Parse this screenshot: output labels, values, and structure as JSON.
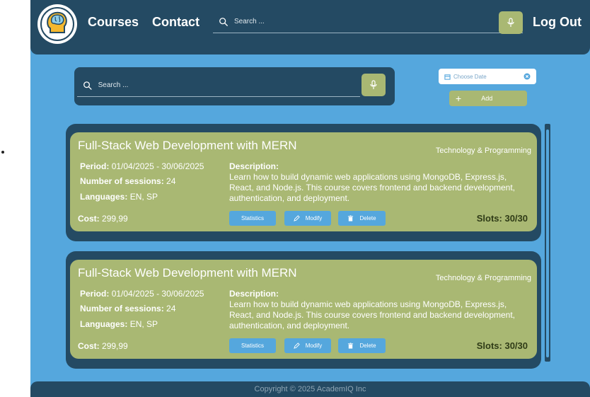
{
  "nav": {
    "courses": "Courses",
    "contact": "Contact",
    "search_placeholder": "Search ...",
    "logout": "Log Out"
  },
  "toolbar": {
    "search_placeholder": "Search ...",
    "date_placeholder": "Choose Date",
    "add_label": "Add",
    "add_symbol": "+"
  },
  "courses": [
    {
      "title": "Full-Stack Web Development with MERN",
      "category": "Technology & Programming",
      "period_label": "Period:",
      "period": "01/04/2025 - 30/06/2025",
      "sessions_label": "Number of sessions:",
      "sessions": "24",
      "languages_label": "Languages:",
      "languages": "EN, SP",
      "description_label": "Description:",
      "description": "Learn how to build dynamic web applications using MongoDB, Express.js, React, and Node.js. This course covers frontend and backend development, authentication, and deployment.",
      "cost_label": "Cost:",
      "cost": "299,99",
      "slots": "Slots: 30/30",
      "buttons": {
        "statistics": "Statistics",
        "modify": "Modify",
        "delete": "Delete"
      }
    },
    {
      "title": "Full-Stack Web Development with MERN",
      "category": "Technology & Programming",
      "period_label": "Period:",
      "period": "01/04/2025 - 30/06/2025",
      "sessions_label": "Number of sessions:",
      "sessions": "24",
      "languages_label": "Languages:",
      "languages": "EN, SP",
      "description_label": "Description:",
      "description": "Learn how to build dynamic web applications using MongoDB, Express.js, React, and Node.js. This course covers frontend and backend development, authentication, and deployment.",
      "cost_label": "Cost:",
      "cost": "299,99",
      "slots": "Slots: 30/30",
      "buttons": {
        "statistics": "Statistics",
        "modify": "Modify",
        "delete": "Delete"
      }
    }
  ],
  "footer": {
    "copyright": "Copyright © 2025 AcademIQ Inc"
  },
  "icons": [
    "brain-head-logo-icon",
    "search-icon",
    "mic-icon",
    "calendar-icon",
    "clear-icon",
    "plus-icon",
    "pencil-icon",
    "trash-icon"
  ],
  "colors": {
    "navy": "#244a63",
    "sky": "#55a7dd",
    "olive": "#a9b873",
    "slots_text": "#2f3b17",
    "white": "#ffffff"
  }
}
